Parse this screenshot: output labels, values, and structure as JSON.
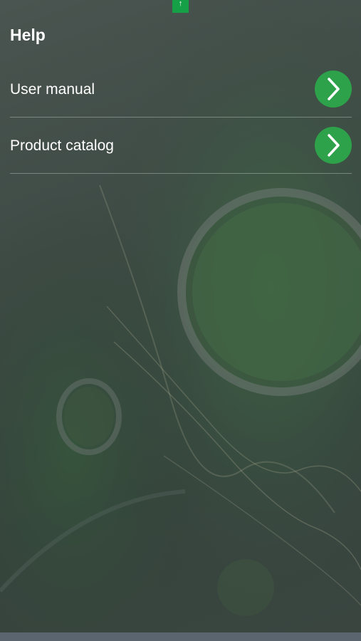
{
  "header": {
    "tab_glyph": "↑",
    "title": "Help"
  },
  "menu": {
    "items": [
      {
        "label": "User manual",
        "icon": "chevron-right-icon"
      },
      {
        "label": "Product catalog",
        "icon": "chevron-right-icon"
      }
    ]
  },
  "colors": {
    "accent": "#2ea24a",
    "tab": "#15a047",
    "text": "#ffffff"
  }
}
